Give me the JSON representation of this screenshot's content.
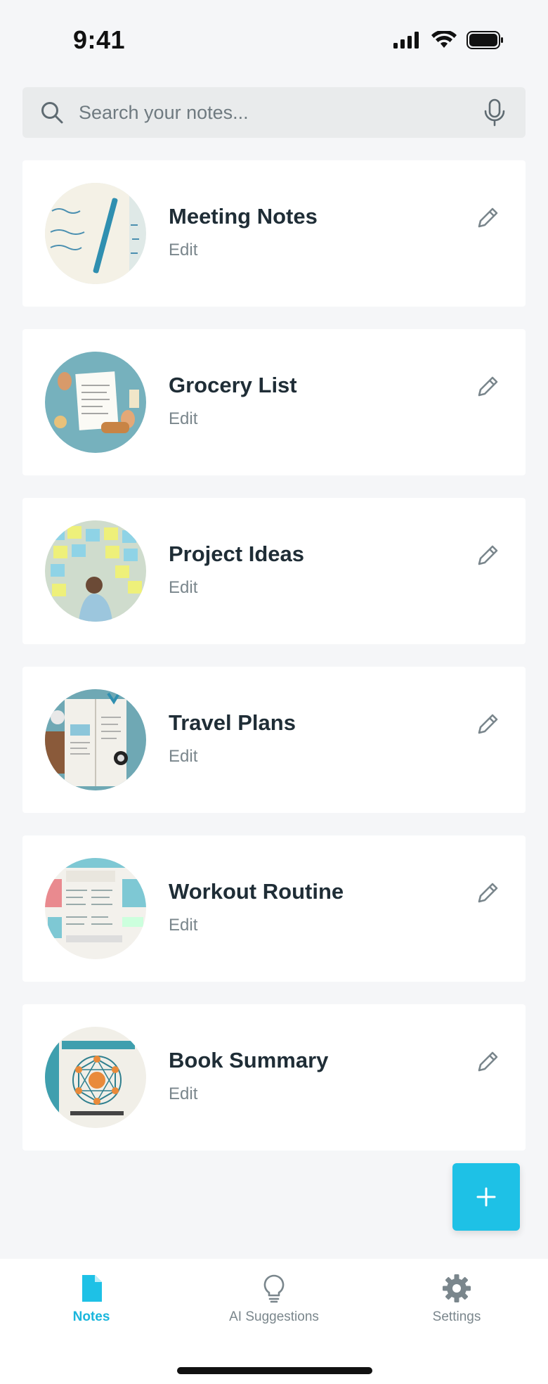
{
  "status_bar": {
    "time": "9:41"
  },
  "search": {
    "placeholder": "Search your notes..."
  },
  "notes": [
    {
      "title": "Meeting Notes",
      "subtitle": "Edit"
    },
    {
      "title": "Grocery List",
      "subtitle": "Edit"
    },
    {
      "title": "Project Ideas",
      "subtitle": "Edit"
    },
    {
      "title": "Travel Plans",
      "subtitle": "Edit"
    },
    {
      "title": "Workout Routine",
      "subtitle": "Edit"
    },
    {
      "title": "Book Summary",
      "subtitle": "Edit"
    }
  ],
  "fab": {
    "label": "+"
  },
  "bottom_nav": {
    "items": [
      {
        "label": "Notes",
        "icon": "document-icon",
        "active": true
      },
      {
        "label": "AI Suggestions",
        "icon": "lightbulb-icon",
        "active": false
      },
      {
        "label": "Settings",
        "icon": "gear-icon",
        "active": false
      }
    ]
  },
  "colors": {
    "accent": "#1ec1e6",
    "active_nav": "#1ab6dc",
    "background": "#f5f6f8",
    "text": "#1f2d36",
    "muted": "#7a868c"
  }
}
